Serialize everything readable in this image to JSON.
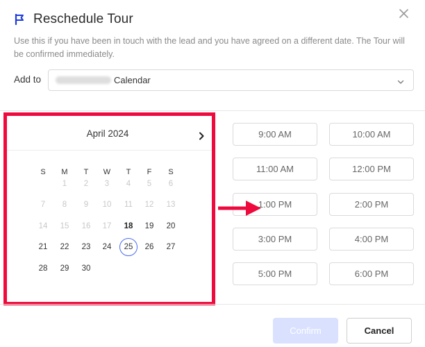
{
  "dialog": {
    "title": "Reschedule Tour",
    "description": "Use this if you have been in touch with the lead and you have agreed on a different date. The Tour will be confirmed immediately."
  },
  "add_to": {
    "label": "Add to",
    "selected_value": "Calendar"
  },
  "calendar": {
    "month_label": "April 2024",
    "weekdays": [
      "S",
      "M",
      "T",
      "W",
      "T",
      "F",
      "S"
    ],
    "weeks": [
      [
        "",
        "1",
        "2",
        "3",
        "4",
        "5",
        "6"
      ],
      [
        "7",
        "8",
        "9",
        "10",
        "11",
        "12",
        "13"
      ],
      [
        "14",
        "15",
        "16",
        "17",
        "18",
        "19",
        "20"
      ],
      [
        "21",
        "22",
        "23",
        "24",
        "25",
        "26",
        "27"
      ],
      [
        "28",
        "29",
        "30",
        "",
        "",
        "",
        ""
      ]
    ],
    "today": "18",
    "selected": "25",
    "first_available": "18"
  },
  "time_slots": [
    [
      "9:00 AM",
      "10:00 AM"
    ],
    [
      "11:00 AM",
      "12:00 PM"
    ],
    [
      "1:00 PM",
      "2:00 PM"
    ],
    [
      "3:00 PM",
      "4:00 PM"
    ],
    [
      "5:00 PM",
      "6:00 PM"
    ]
  ],
  "buttons": {
    "confirm": "Confirm",
    "cancel": "Cancel"
  },
  "colors": {
    "accent": "#1d3bdb",
    "highlight": "#ee0a3c",
    "selected_ring": "#4b6cf0",
    "confirm_disabled": "#d9e1ff"
  },
  "icons": {
    "title": "flag-icon",
    "close": "close-icon",
    "dropdown": "chevron-down-icon",
    "next_month": "chevron-right-icon",
    "annotation": "arrow-right-icon"
  }
}
